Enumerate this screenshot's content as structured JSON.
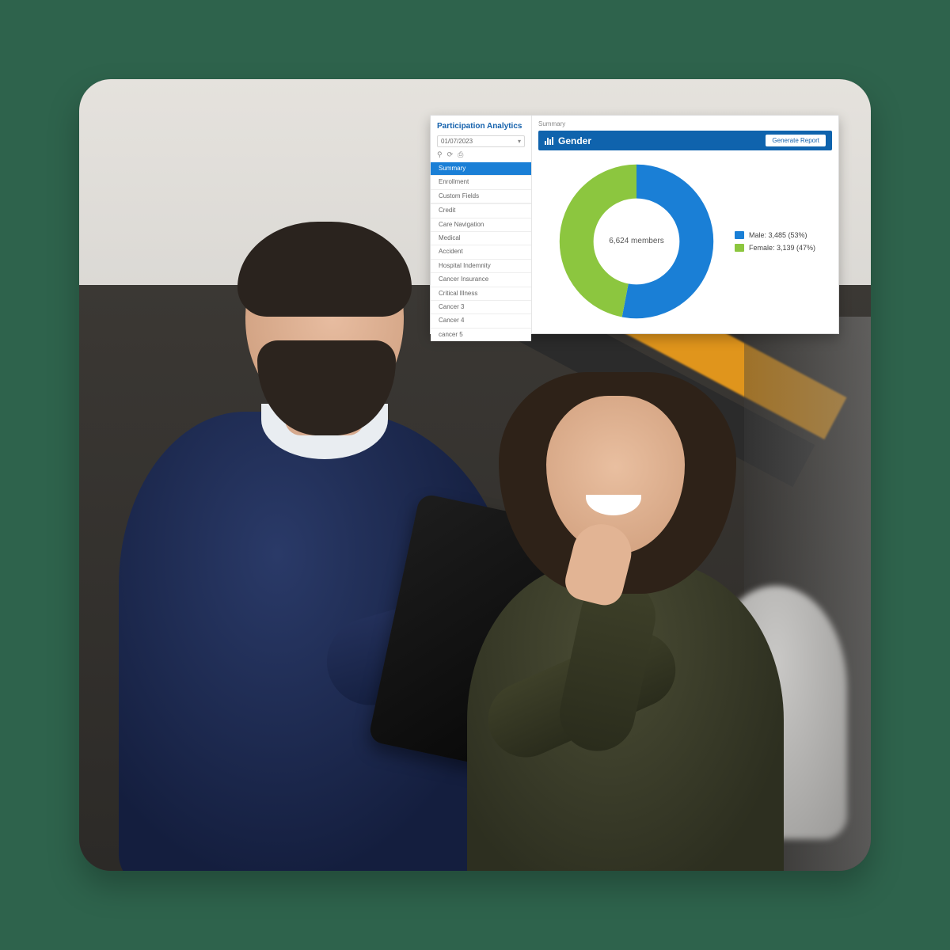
{
  "analytics": {
    "title": "Participation Analytics",
    "date": "01/07/2023",
    "breadcrumb": "Summary",
    "nav_primary": [
      {
        "label": "Summary",
        "selected": true
      },
      {
        "label": "Enrollment",
        "selected": false
      },
      {
        "label": "Custom Fields",
        "selected": false
      }
    ],
    "nav_secondary": [
      {
        "label": "Credit"
      },
      {
        "label": "Care Navigation"
      },
      {
        "label": "Medical"
      },
      {
        "label": "Accident"
      },
      {
        "label": "Hospital Indemnity"
      },
      {
        "label": "Cancer Insurance"
      },
      {
        "label": "Critical Illness"
      },
      {
        "label": "Cancer 3"
      },
      {
        "label": "Cancer 4"
      },
      {
        "label": "cancer 5"
      }
    ],
    "icons": {
      "filter": "filter-icon",
      "refresh": "refresh-icon",
      "print": "print-icon"
    }
  },
  "gender_card": {
    "title": "Gender",
    "button": "Generate Report",
    "center_label": "6,624 members"
  },
  "chart_data": {
    "type": "pie",
    "title": "Gender",
    "total_label": "6,624 members",
    "total_value": 6624,
    "series": [
      {
        "name": "Male",
        "value": 3485,
        "percent": 53,
        "label": "Male: 3,485 (53%)",
        "color": "#1a7fd6"
      },
      {
        "name": "Female",
        "value": 3139,
        "percent": 47,
        "label": "Female: 3,139 (47%)",
        "color": "#8cc63f"
      }
    ]
  },
  "colors": {
    "page_bg": "#2e634c",
    "brand_blue": "#0f63ad",
    "accent_blue": "#1a7fd6",
    "accent_green": "#8cc63f"
  }
}
